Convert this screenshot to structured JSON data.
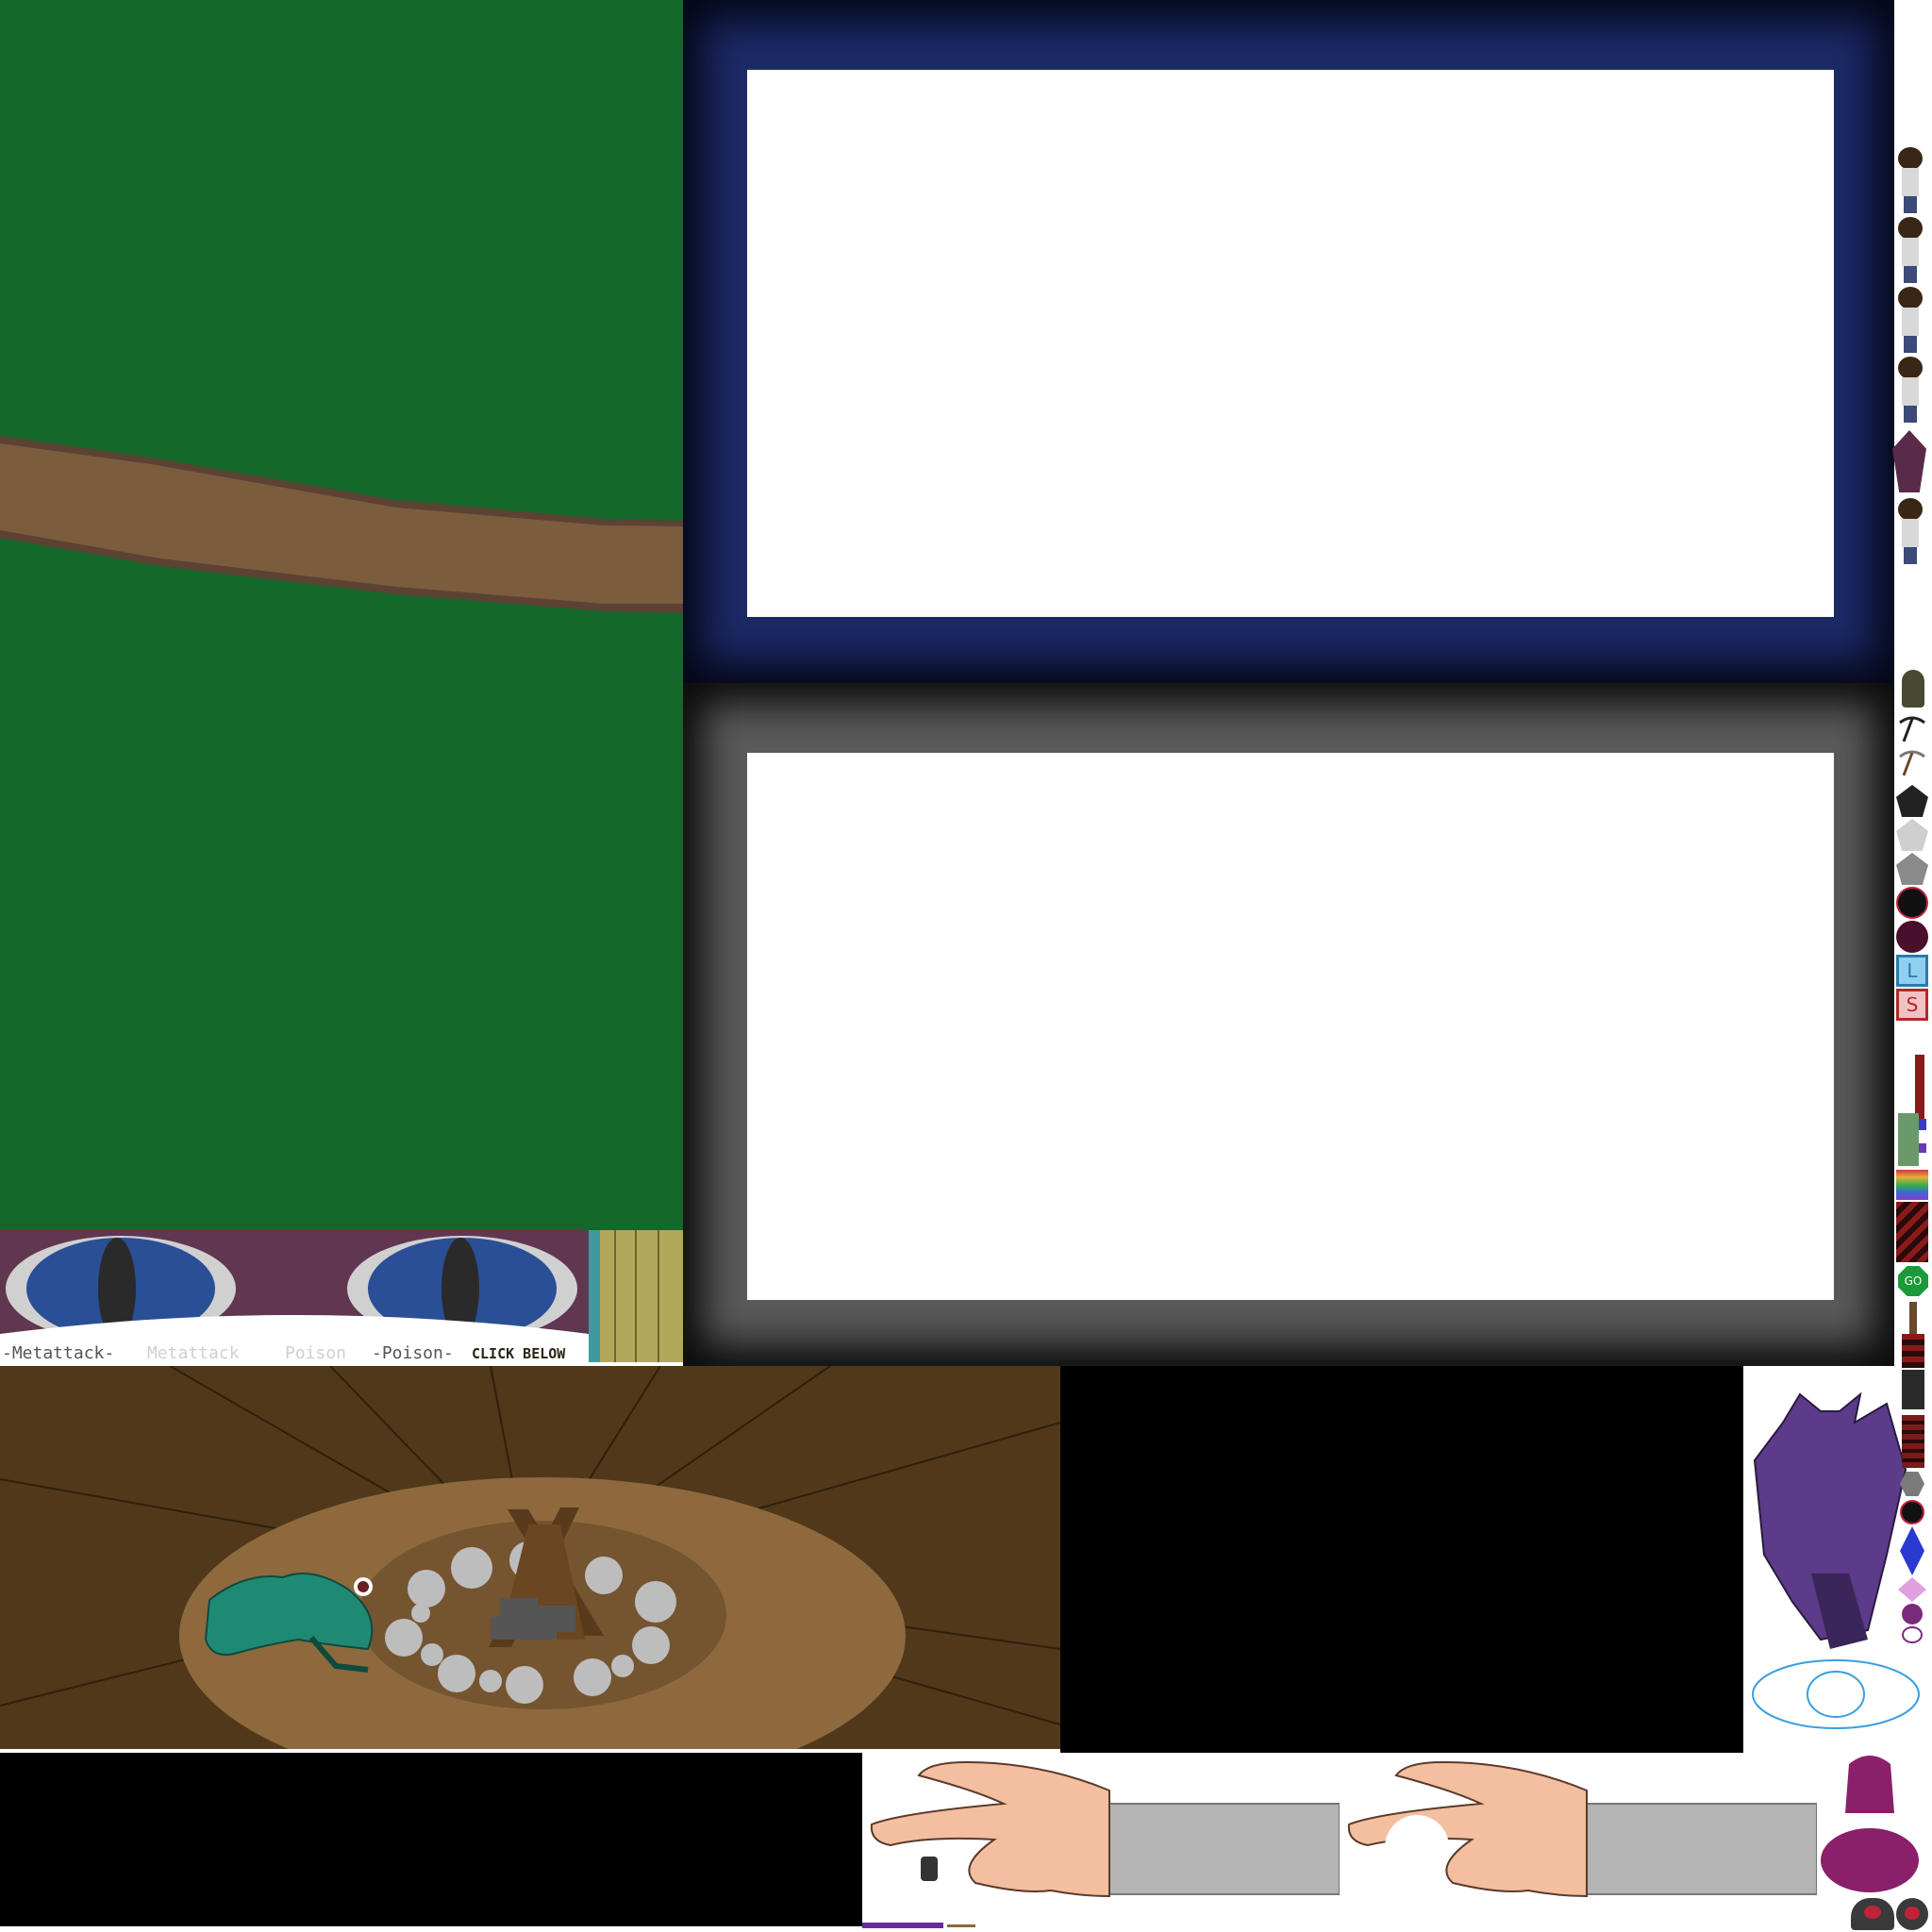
{
  "sprite_sheet": {
    "attack_labels": {
      "metattack_active": "-Metattack-",
      "metattack_inactive": "Metattack",
      "poison_inactive": "Poison",
      "poison_active": "-Poison-",
      "click_below": "CLICK BELOW"
    },
    "go_button_label": "GO",
    "tile_letters": {
      "blue": "L",
      "red": "S"
    }
  },
  "colors": {
    "forest": "#14682a",
    "branch": "#7b5c3d",
    "blue_frame": "#1c2a66",
    "gray_frame": "#5a5a5a",
    "cave_floor": "#51381a",
    "cave_clearing": "#8d693d",
    "eye_iris": "#2a4f96",
    "eye_lid": "#613650",
    "skin": "#f4bea0",
    "sleeve": "#b4b4b4",
    "salamander": "#1f8a73",
    "demon": "#5c3b8a"
  }
}
